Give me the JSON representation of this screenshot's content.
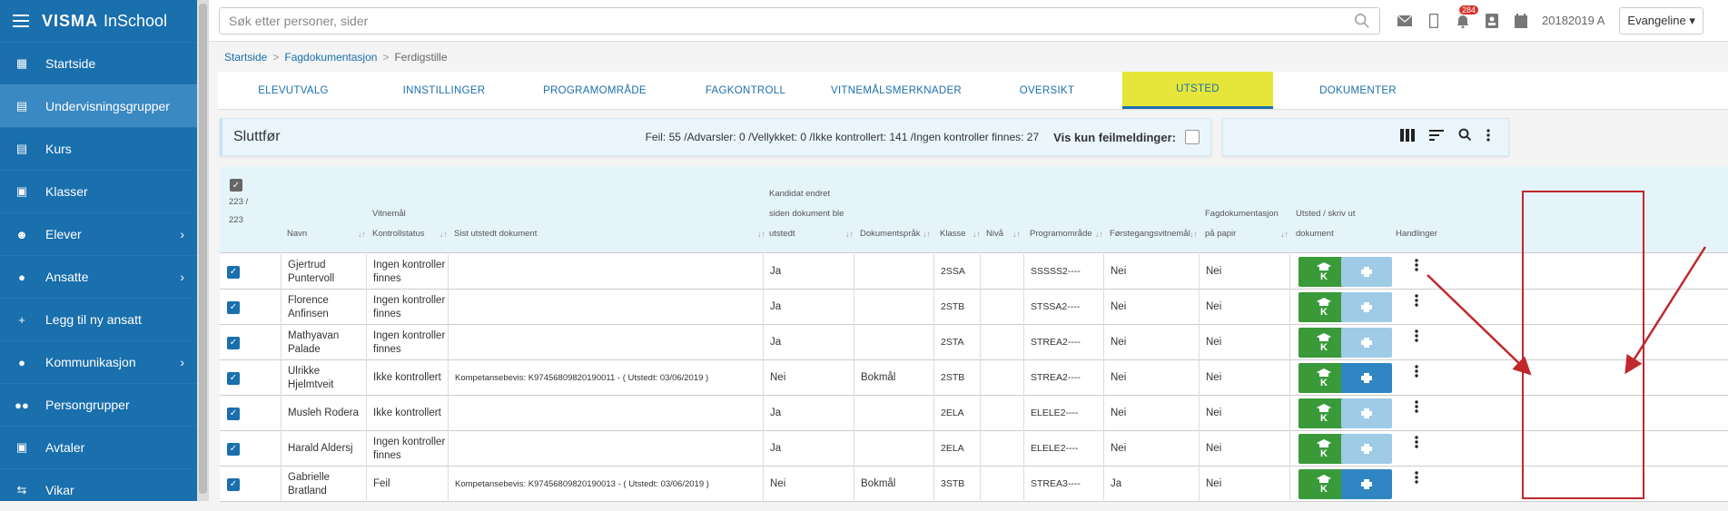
{
  "app": {
    "brand_mark": "VISMA",
    "brand_sub": "InSchool"
  },
  "sidebar": {
    "items": [
      {
        "label": "Startside",
        "icon": "grid-icon",
        "glyph": "▦"
      },
      {
        "label": "Undervisningsgrupper",
        "icon": "book-icon",
        "glyph": "▤"
      },
      {
        "label": "Kurs",
        "icon": "book-icon",
        "glyph": "▤"
      },
      {
        "label": "Klasser",
        "icon": "classroom-icon",
        "glyph": "▣"
      },
      {
        "label": "Elever",
        "icon": "student-icon",
        "glyph": "☻",
        "chevron": "›"
      },
      {
        "label": "Ansatte",
        "icon": "person-icon",
        "glyph": "●",
        "chevron": "›"
      },
      {
        "label": "Legg til ny ansatt",
        "icon": "plus-icon",
        "glyph": "+"
      },
      {
        "label": "Kommunikasjon",
        "icon": "chat-icon",
        "glyph": "●",
        "chevron": "›"
      },
      {
        "label": "Persongrupper",
        "icon": "group-icon",
        "glyph": "●●"
      },
      {
        "label": "Avtaler",
        "icon": "calendar-icon",
        "glyph": "▣"
      },
      {
        "label": "Vikar",
        "icon": "swap-icon",
        "glyph": "⇆"
      }
    ]
  },
  "topbar": {
    "search_placeholder": "Søk etter personer, sider",
    "notification_count": "284",
    "school_year": "20182019 A",
    "user": "Evangeline ▾"
  },
  "breadcrumb": [
    "Startside",
    "Fagdokumentasjon",
    "Ferdigstille"
  ],
  "tabs": [
    "ELEVUTVALG",
    "INNSTILLINGER",
    "PROGRAMOMRÅDE",
    "FAGKONTROLL",
    "VITNEMÅLSMERKNADER",
    "OVERSIKT",
    "UTSTED",
    "DOKUMENTER"
  ],
  "active_tab": "UTSTED",
  "panel": {
    "title": "Sluttfør",
    "stats": "Feil: 55 /Advarsler: 0 /Vellykket: 0 /Ikke kontrollert: 141 /Ingen kontroller finnes: 27",
    "filter_label": "Vis kun feilmeldinger:"
  },
  "table": {
    "selected_count": "223 /",
    "total_count": "223",
    "headers": {
      "navn": "Navn",
      "vitnemal": "Vitnemål",
      "kontrollstatus": "Kontrollstatus",
      "sist_utstedt": "Sist utstedt dokument",
      "kandidat_1": "Kandidat endret",
      "kandidat_2": "siden dokument ble",
      "kandidat_3": "utstedt",
      "dokumentsprak": "Dokumentspråk",
      "klasse": "Klasse",
      "niva": "Nivå",
      "programomrade": "Programområde",
      "forstegang": "Førstegangsvitnemål",
      "fagdok_1": "Fagdokumentasjon",
      "fagdok_2": "på papir",
      "utsted_1": "Utsted / skriv ut",
      "utsted_2": "dokument",
      "handlinger": "Handlinger"
    },
    "k_label": "K",
    "rows": [
      {
        "name1": "Gjertrud",
        "name2": "Puntervoll",
        "status1": "Ingen kontroller",
        "status2": "finnes",
        "doc": "",
        "changed": "Ja",
        "lang": "",
        "klasse": "2SSA",
        "niva": "",
        "prog": "SSSSS2----",
        "first": "Nei",
        "paper": "Nei",
        "print_active": false
      },
      {
        "name1": "Florence",
        "name2": "Anfinsen",
        "status1": "Ingen kontroller",
        "status2": "finnes",
        "doc": "",
        "changed": "Ja",
        "lang": "",
        "klasse": "2STB",
        "niva": "",
        "prog": "STSSA2----",
        "first": "Nei",
        "paper": "Nei",
        "print_active": false
      },
      {
        "name1": "Mathyavan",
        "name2": "Palade",
        "status1": "Ingen kontroller",
        "status2": "finnes",
        "doc": "",
        "changed": "Ja",
        "lang": "",
        "klasse": "2STA",
        "niva": "",
        "prog": "STREA2----",
        "first": "Nei",
        "paper": "Nei",
        "print_active": false
      },
      {
        "name1": "Ulrikke",
        "name2": "Hjelmtveit",
        "status1": "Ikke kontrollert",
        "status2": "",
        "doc": "Kompetansebevis: K97456809820190011 - ( Utstedt: 03/06/2019 )",
        "changed": "Nei",
        "lang": "Bokmål",
        "klasse": "2STB",
        "niva": "",
        "prog": "STREA2----",
        "first": "Nei",
        "paper": "Nei",
        "print_active": true
      },
      {
        "name1": "Musleh Rodera",
        "name2": "",
        "status1": "Ikke kontrollert",
        "status2": "",
        "doc": "",
        "changed": "Ja",
        "lang": "",
        "klasse": "2ELA",
        "niva": "",
        "prog": "ELELE2----",
        "first": "Nei",
        "paper": "Nei",
        "print_active": false
      },
      {
        "name1": "Harald Aldersj",
        "name2": "",
        "status1": "Ingen kontroller",
        "status2": "finnes",
        "doc": "",
        "changed": "Ja",
        "lang": "",
        "klasse": "2ELA",
        "niva": "",
        "prog": "ELELE2----",
        "first": "Nei",
        "paper": "Nei",
        "print_active": false
      },
      {
        "name1": "Gabrielle",
        "name2": "Bratland",
        "status1": "Feil",
        "status2": "",
        "doc": "Kompetansebevis: K97456809820190013 - ( Utstedt: 03/06/2019 )",
        "changed": "Nei",
        "lang": "Bokmål",
        "klasse": "3STB",
        "niva": "",
        "prog": "STREA3----",
        "first": "Ja",
        "paper": "Nei",
        "print_active": true
      }
    ]
  },
  "colors": {
    "sidebar": "#1a6fad",
    "active_tab": "#e6e63a",
    "k_button": "#3a9a3a",
    "print_active": "#2f86c2",
    "print_inactive": "#9fcbe6",
    "annotation": "#c0282c"
  }
}
